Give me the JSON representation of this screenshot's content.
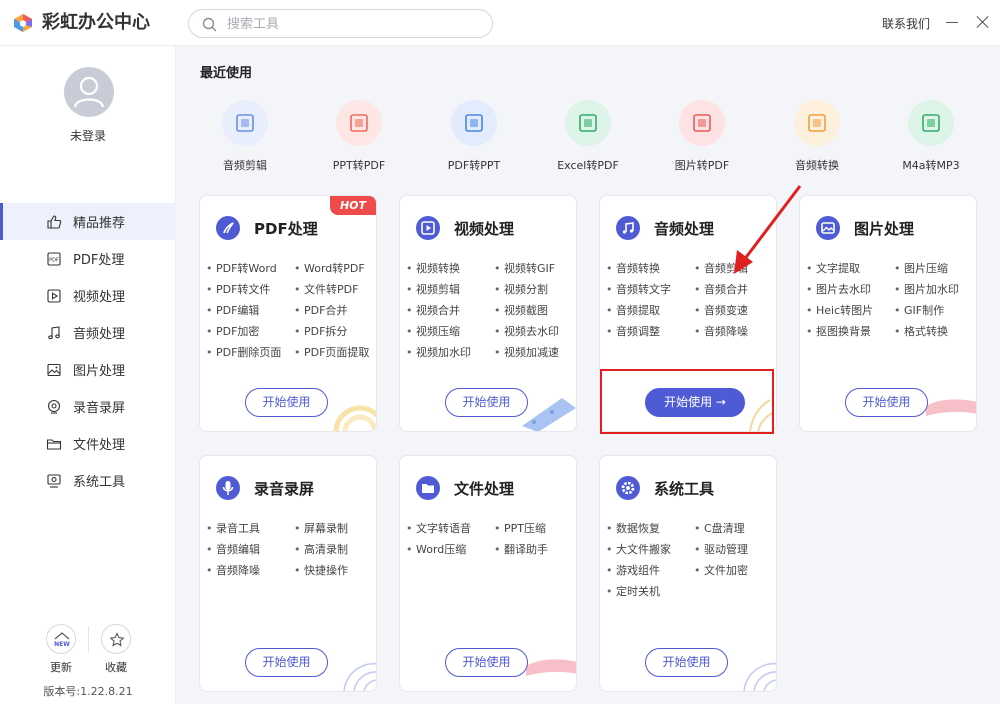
{
  "app": {
    "title": "彩虹办公中心",
    "contact": "联系我们",
    "search_placeholder": "搜索工具",
    "icons": {
      "minimize": "minimize-icon",
      "close": "close-icon"
    }
  },
  "sidebar": {
    "login_label": "未登录",
    "items": [
      {
        "label": "精品推荐",
        "icon": "thumbs-up-icon",
        "active": true
      },
      {
        "label": "PDF处理",
        "icon": "pdf-file-icon"
      },
      {
        "label": "视频处理",
        "icon": "video-icon"
      },
      {
        "label": "音频处理",
        "icon": "music-note-icon"
      },
      {
        "label": "图片处理",
        "icon": "image-icon"
      },
      {
        "label": "录音录屏",
        "icon": "record-icon"
      },
      {
        "label": "文件处理",
        "icon": "folder-icon"
      },
      {
        "label": "系统工具",
        "icon": "system-tool-icon"
      }
    ],
    "update_label": "更新",
    "update_badge": "NEW",
    "collect_label": "收藏",
    "version": "版本号:1.22.8.21"
  },
  "recent": {
    "title": "最近使用",
    "items": [
      {
        "label": "音频剪辑",
        "icon": "audio-cut-icon",
        "color": "#6b8fe8",
        "bg": "#e8eefc"
      },
      {
        "label": "PPT转PDF",
        "icon": "ppt-to-pdf-icon",
        "color": "#ef6a5a",
        "bg": "#fde6e3"
      },
      {
        "label": "PDF转PPT",
        "icon": "pdf-to-ppt-icon",
        "color": "#4a86e8",
        "bg": "#e3ecfd"
      },
      {
        "label": "Excel转PDF",
        "icon": "excel-to-pdf-icon",
        "color": "#2fae6a",
        "bg": "#def4e8"
      },
      {
        "label": "图片转PDF",
        "icon": "image-to-pdf-icon",
        "color": "#ef5a5a",
        "bg": "#fde3e3"
      },
      {
        "label": "音频转换",
        "icon": "audio-convert-icon",
        "color": "#f0a03c",
        "bg": "#fdf0dc"
      },
      {
        "label": "M4a转MP3",
        "icon": "m4a-to-mp3-icon",
        "color": "#2fae6a",
        "bg": "#def4e8"
      }
    ]
  },
  "cards": [
    {
      "title": "PDF处理",
      "icon": "pdf-icon",
      "hot": "HOT",
      "button": "开始使用",
      "features": [
        "PDF转Word",
        "Word转PDF",
        "PDF转文件",
        "文件转PDF",
        "PDF编辑",
        "PDF合并",
        "PDF加密",
        "PDF拆分",
        "PDF删除页面",
        "PDF页面提取"
      ]
    },
    {
      "title": "视频处理",
      "icon": "video-play-icon",
      "button": "开始使用",
      "features": [
        "视频转换",
        "视频转GIF",
        "视频剪辑",
        "视频分割",
        "视频合并",
        "视频截图",
        "视频压缩",
        "视频去水印",
        "视频加水印",
        "视频加减速"
      ]
    },
    {
      "title": "音频处理",
      "icon": "music-icon",
      "button": "开始使用 →",
      "features": [
        "音频转换",
        "音频剪辑",
        "音频转文字",
        "音频合并",
        "音频提取",
        "音频变速",
        "音频调整",
        "音频降噪"
      ]
    },
    {
      "title": "图片处理",
      "icon": "picture-icon",
      "button": "开始使用",
      "features": [
        "文字提取",
        "图片压缩",
        "图片去水印",
        "图片加水印",
        "Heic转图片",
        "GIF制作",
        "抠图换背景",
        "格式转换"
      ]
    },
    {
      "title": "录音录屏",
      "icon": "microphone-icon",
      "button": "开始使用",
      "features": [
        "录音工具",
        "屏幕录制",
        "音频编辑",
        "高清录制",
        "音频降噪",
        "快捷操作"
      ]
    },
    {
      "title": "文件处理",
      "icon": "folder-icon",
      "button": "开始使用",
      "features": [
        "文字转语音",
        "PPT压缩",
        "Word压缩",
        "翻译助手"
      ]
    },
    {
      "title": "系统工具",
      "icon": "settings-gear-icon",
      "button": "开始使用",
      "features": [
        "数据恢复",
        "C盘清理",
        "大文件搬家",
        "驱动管理",
        "游戏组件",
        "文件加密",
        "定时关机"
      ]
    }
  ],
  "colors": {
    "accent": "#4f5bd5",
    "hot": "#ef4b4b",
    "highlight": "#e02020"
  }
}
